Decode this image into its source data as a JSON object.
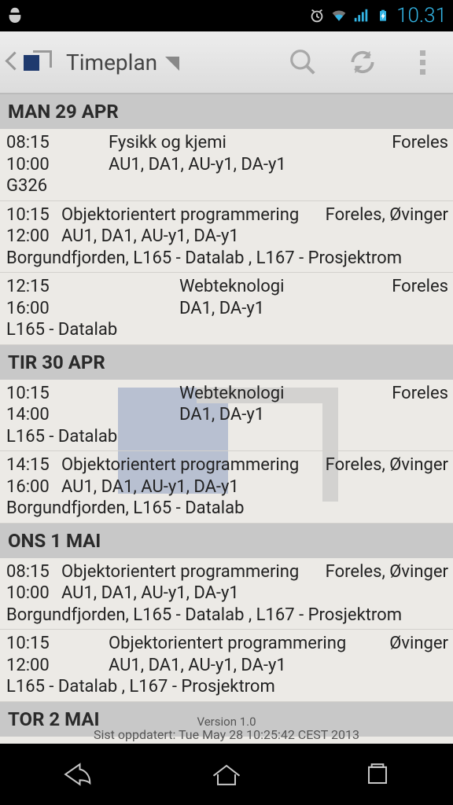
{
  "statusbar": {
    "time": "10.31"
  },
  "actionbar": {
    "title": "Timeplan"
  },
  "days": [
    {
      "label": "MAN 29 APR",
      "entries": [
        {
          "start": "08:15",
          "end": "10:00",
          "title": "Fysikk og kjemi",
          "groups": "AU1, DA1, AU-y1, DA-y1",
          "type": "Foreles",
          "room": "G326",
          "indent": true
        },
        {
          "start": "10:15",
          "end": "12:00",
          "title": "Objektorientert programmering",
          "groups": "AU1, DA1, AU-y1, DA-y1",
          "type": "Foreles, Øvinger",
          "room": "Borgundfjorden, L165 - Datalab , L167 - Prosjektrom"
        },
        {
          "start": "12:15",
          "end": "16:00",
          "title": "Webteknologi",
          "groups": "DA1, DA-y1",
          "type": "Foreles",
          "room": "L165 - Datalab",
          "indent": true,
          "midpad": true
        }
      ]
    },
    {
      "label": "TIR 30 APR",
      "entries": [
        {
          "start": "10:15",
          "end": "14:00",
          "title": "Webteknologi",
          "groups": "DA1, DA-y1",
          "type": "Foreles",
          "room": "L165 - Datalab",
          "indent": true,
          "midpad": true
        },
        {
          "start": "14:15",
          "end": "16:00",
          "title": "Objektorientert programmering",
          "groups": "AU1, DA1, AU-y1, DA-y1",
          "type": "Foreles, Øvinger",
          "room": "Borgundfjorden, L165 - Datalab"
        }
      ]
    },
    {
      "label": "ONS 1 MAI",
      "entries": [
        {
          "start": "08:15",
          "end": "10:00",
          "title": "Objektorientert programmering",
          "groups": "AU1, DA1, AU-y1, DA-y1",
          "type": "Foreles, Øvinger",
          "room": "Borgundfjorden, L165 - Datalab , L167 - Prosjektrom"
        },
        {
          "start": "10:15",
          "end": "12:00",
          "title": "Objektorientert programmering",
          "groups": "AU1, DA1, AU-y1, DA-y1",
          "type": "Øvinger",
          "room": "L165 - Datalab , L167 - Prosjektrom",
          "indent": true
        }
      ]
    },
    {
      "label": "TOR 2 MAI",
      "entries": []
    }
  ],
  "footer": {
    "version": "Version 1.0",
    "updated": "Sist oppdatert: Tue May 28 10:25:42 CEST 2013"
  }
}
